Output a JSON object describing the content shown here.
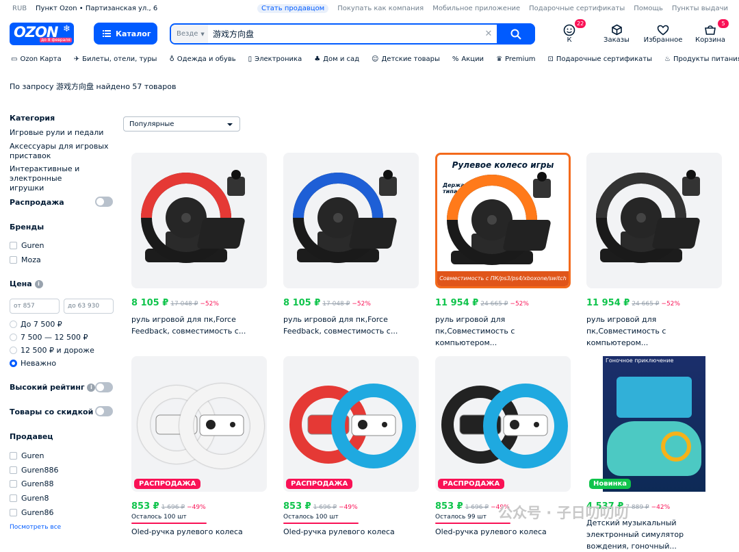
{
  "topbar": {
    "currency": "RUB",
    "address": "Пункт Ozon • Партизанская ул., 6",
    "links": [
      "Стать продавцом",
      "Покупать как компания",
      "Мобильное приложение",
      "Подарочные сертификаты",
      "Помощь",
      "Пункты выдачи"
    ]
  },
  "logo": {
    "text": "OZON",
    "sub": "до 8 февраля"
  },
  "header": {
    "catalog": "Каталог",
    "scope": "Везде",
    "query": "游戏方向盘",
    "actions": [
      {
        "label": "К",
        "badge": "22"
      },
      {
        "label": "Заказы",
        "badge": ""
      },
      {
        "label": "Избранное",
        "badge": ""
      },
      {
        "label": "Корзина",
        "badge": "5"
      }
    ]
  },
  "nav": [
    "Ozon Карта",
    "Билеты, отели, туры",
    "Одежда и обувь",
    "Электроника",
    "Дом и сад",
    "Детские товары",
    "Акции",
    "Premium",
    "Подарочные сертификаты",
    "Продукты питания"
  ],
  "results": "По запросу 游戏方向盘 найдено 57 товаров",
  "sidebar": {
    "category_title": "Категория",
    "categories": [
      "Игровые рули и педали",
      "Аксессуары для игровых приставок",
      "Интерактивные и электронные игрушки"
    ],
    "sale": "Распродажа",
    "brands_title": "Бренды",
    "brands": [
      "Guren",
      "Moza"
    ],
    "price_title": "Цена",
    "price_from": "от 857",
    "price_to": "до 63 930",
    "price_options": [
      "До 7 500 ₽",
      "7 500 — 12 500 ₽",
      "12 500 ₽ и дороже",
      "Неважно"
    ],
    "high_rating": "Высокий рейтинг",
    "discount": "Товары со скидкой",
    "seller_title": "Продавец",
    "sellers": [
      "Guren",
      "Guren886",
      "Guren88",
      "Guren8",
      "Guren86"
    ],
    "see_all": "Посмотреть все"
  },
  "sort": "Популярные",
  "products": [
    {
      "price": "8 105 ₽",
      "old": "17 048 ₽",
      "disc": "−52%",
      "name": "руль игровой для пк,Force Feedback, совместимость с...",
      "wheel": "#e53935"
    },
    {
      "price": "8 105 ₽",
      "old": "17 048 ₽",
      "disc": "−52%",
      "name": "руль игровой для пк,Force Feedback, совместимость с...",
      "wheel": "#1e5fd6"
    },
    {
      "price": "11 954 ₽",
      "old": "24 665 ₽",
      "disc": "−52%",
      "name": "руль игровой для пк,Совместимость с компьютером...",
      "wheel": "#ff7a1a",
      "banner_title": "Рулевое колесо игры",
      "banner_holder": "Держатель типа С",
      "banner_bottom": "Совместимость с ПК/ps3/ps4/xboxone/switch"
    },
    {
      "price": "11 954 ₽",
      "old": "24 665 ₽",
      "disc": "−52%",
      "name": "руль игровой для пк,Совместимость с компьютером...",
      "wheel": "#333333"
    },
    {
      "price": "853 ₽",
      "old": "1 696 ₽",
      "disc": "−49%",
      "left": "Осталось 100 шт",
      "name": "Oled-ручка рулевого колеса",
      "badge": "РАСПРОДАЖА",
      "wheel": "#f4f4f4",
      "wheel2": "#f4f4f4"
    },
    {
      "price": "853 ₽",
      "old": "1 696 ₽",
      "disc": "−49%",
      "left": "Осталось 100 шт",
      "name": "Oled-ручка рулевого колеса",
      "badge": "РАСПРОДАЖА",
      "wheel": "#e53935",
      "wheel2": "#1fa9e0"
    },
    {
      "price": "853 ₽",
      "old": "1 696 ₽",
      "disc": "−49%",
      "left": "Осталось 99 шт",
      "name": "Oled-ручка рулевого колеса",
      "badge": "РАСПРОДАЖА",
      "wheel": "#222222",
      "wheel2": "#1fa9e0"
    },
    {
      "price": "4 537 ₽",
      "old": "7 889 ₽",
      "disc": "−42%",
      "name": "Детский музыкальный электронный симулятор вождения, гоночный...",
      "badge": "Новинка",
      "caption": "Гоночное приключение"
    }
  ],
  "watermark": "公众号 · 子日叨叨叨"
}
